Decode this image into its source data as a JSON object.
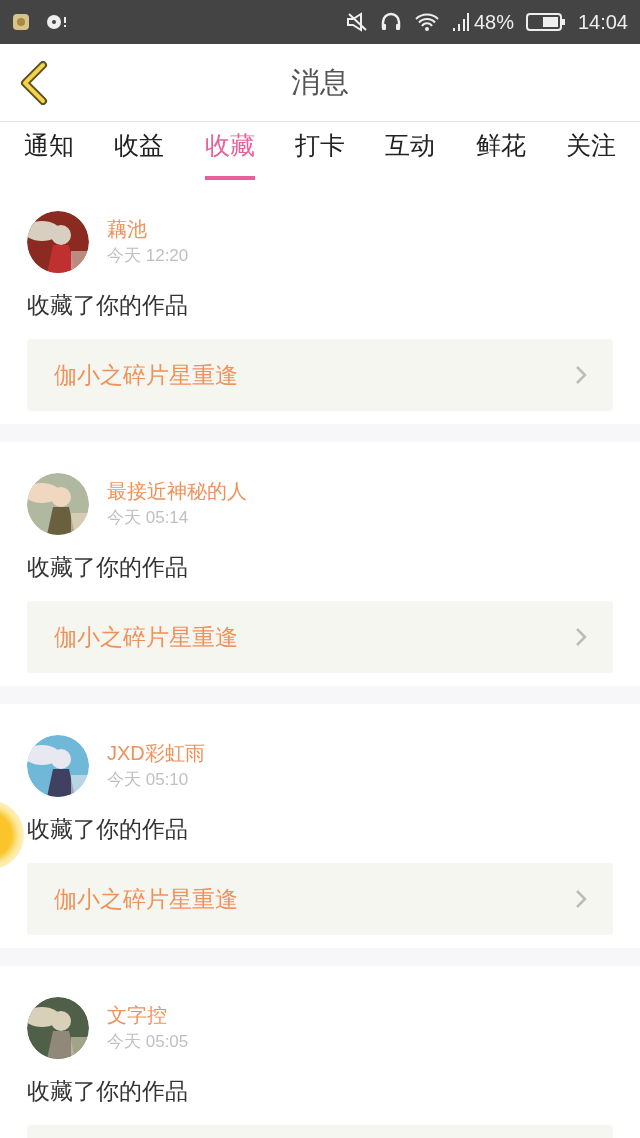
{
  "status_bar": {
    "battery_text": "48%",
    "time": "14:04"
  },
  "header": {
    "title": "消息"
  },
  "tabs": [
    {
      "label": "通知",
      "selected": false
    },
    {
      "label": "收益",
      "selected": false
    },
    {
      "label": "收藏",
      "selected": true
    },
    {
      "label": "打卡",
      "selected": false
    },
    {
      "label": "互动",
      "selected": false
    },
    {
      "label": "鲜花",
      "selected": false
    },
    {
      "label": "关注",
      "selected": false
    }
  ],
  "messages": [
    {
      "name": "藕池",
      "time": "今天 12:20",
      "action": "收藏了你的作品",
      "work": "伽小之碎片星重逢"
    },
    {
      "name": "最接近神秘的人",
      "time": "今天 05:14",
      "action": "收藏了你的作品",
      "work": "伽小之碎片星重逢"
    },
    {
      "name": "JXD彩虹雨",
      "time": "今天 05:10",
      "action": "收藏了你的作品",
      "work": "伽小之碎片星重逢"
    },
    {
      "name": "文字控",
      "time": "今天 05:05",
      "action": "收藏了你的作品"
    }
  ]
}
